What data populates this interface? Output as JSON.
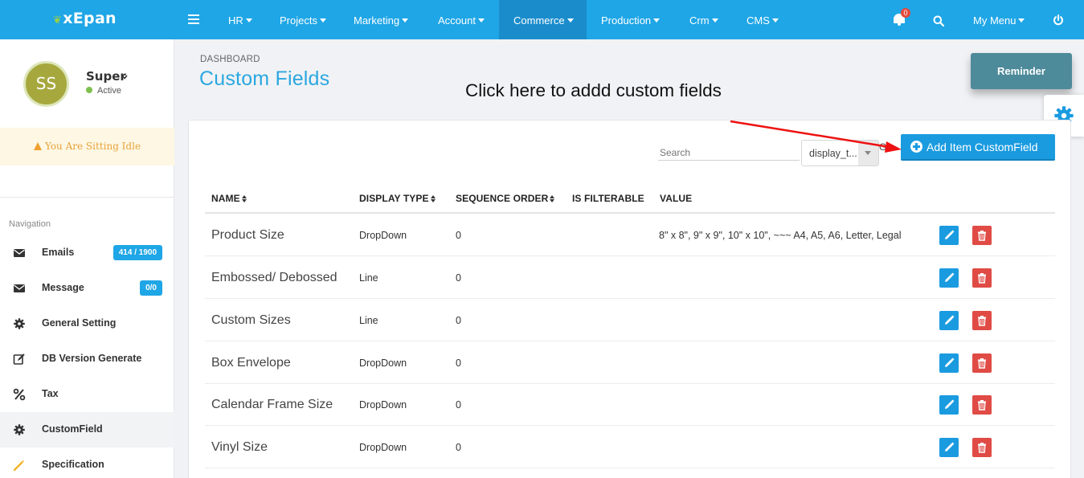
{
  "app": {
    "logo": "xEpan"
  },
  "topnav": {
    "items": [
      {
        "label": "HR"
      },
      {
        "label": "Projects"
      },
      {
        "label": "Marketing"
      },
      {
        "label": "Account"
      },
      {
        "label": "Commerce"
      },
      {
        "label": "Production"
      },
      {
        "label": "Crm"
      },
      {
        "label": "CMS"
      }
    ],
    "active": "Commerce",
    "notifications_count": "0",
    "my_menu": "My Menu"
  },
  "user": {
    "initials": "SS",
    "name": "Super",
    "status": "Active",
    "idle_message": "You Are Sitting Idle"
  },
  "sidebar": {
    "section_label": "Navigation",
    "items": [
      {
        "label": "Emails",
        "badge": "414 / 1900",
        "icon": "envelope-icon"
      },
      {
        "label": "Message",
        "badge": "0/0",
        "icon": "envelope-icon"
      },
      {
        "label": "General Setting",
        "icon": "gear-icon"
      },
      {
        "label": "DB Version Generate",
        "icon": "edit-icon"
      },
      {
        "label": "Tax",
        "icon": "percent-icon"
      },
      {
        "label": "CustomField",
        "icon": "gear-icon",
        "active": true
      },
      {
        "label": "Specification",
        "icon": "magic-wand-icon"
      }
    ]
  },
  "page": {
    "breadcrumb": "DASHBOARD",
    "title": "Custom Fields",
    "annotation": "Click here to addd custom fields",
    "reminder_label": "Reminder",
    "search_placeholder": "Search",
    "filter_value": "display_t...",
    "filter_trailing": "G",
    "add_button_label": "Add Item CustomField"
  },
  "table": {
    "headers": {
      "name": "NAME",
      "display_type": "DISPLAY TYPE",
      "sequence_order": "SEQUENCE ORDER",
      "is_filterable": "IS FILTERABLE",
      "value": "VALUE"
    },
    "rows": [
      {
        "name": "Product Size",
        "display_type": "DropDown",
        "sequence_order": "0",
        "value": "8\" x 8\", 9\" x 9\", 10\" x 10\", ~~~ A4, A5, A6, Letter, Legal"
      },
      {
        "name": "Embossed/ Debossed",
        "display_type": "Line",
        "sequence_order": "0",
        "value": ""
      },
      {
        "name": "Custom Sizes",
        "display_type": "Line",
        "sequence_order": "0",
        "value": ""
      },
      {
        "name": "Box Envelope",
        "display_type": "DropDown",
        "sequence_order": "0",
        "value": ""
      },
      {
        "name": "Calendar Frame Size",
        "display_type": "DropDown",
        "sequence_order": "0",
        "value": ""
      },
      {
        "name": "Vinyl Size",
        "display_type": "DropDown",
        "sequence_order": "0",
        "value": ""
      }
    ]
  },
  "colors": {
    "topbar": "#1fa6e6",
    "active_nav": "#1a8ccb",
    "title": "#2aa7e0",
    "edit_button": "#1a9be0",
    "delete_button": "#e04b45",
    "annotation_arrow": "#ee1111"
  }
}
